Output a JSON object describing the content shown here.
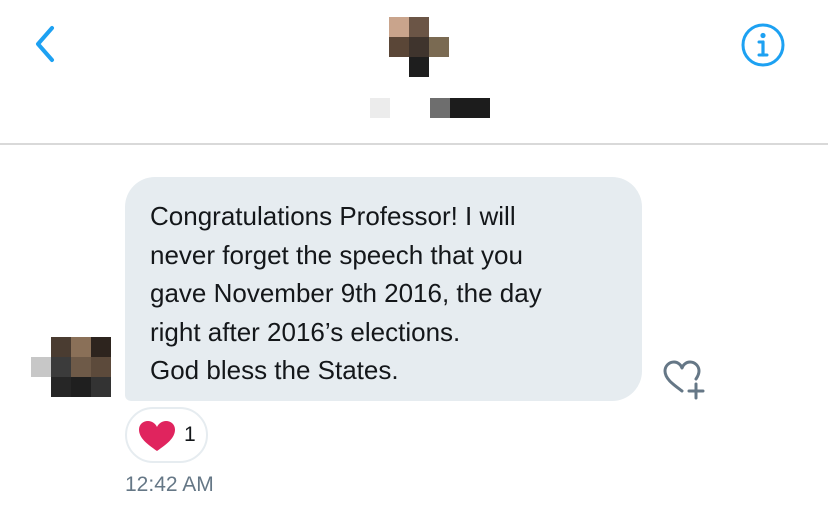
{
  "header": {
    "back_icon": "chevron-left-icon",
    "info_icon": "info-circle-icon",
    "accent_color": "#1da1f2"
  },
  "message": {
    "lines": [
      "Congratulations Professor! I will",
      "never forget the speech that you",
      "gave November 9th 2016, the day",
      "right after 2016’s elections.",
      "God bless the States."
    ],
    "bubble_color": "#e6ecf0",
    "like_icon": "heart-plus-icon",
    "reaction": {
      "icon": "heart-icon",
      "count": "1",
      "color": "#e0245e"
    },
    "timestamp": "12:42 AM"
  }
}
